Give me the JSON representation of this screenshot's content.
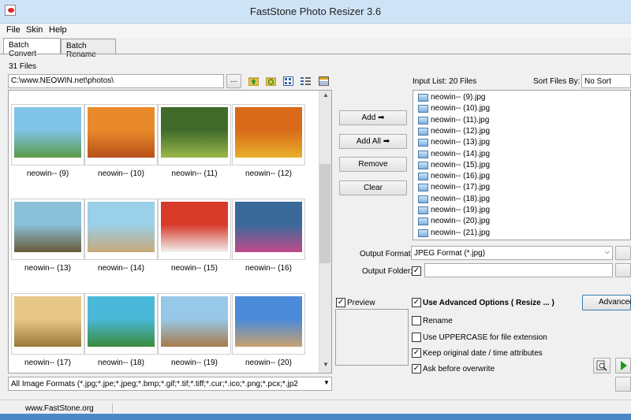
{
  "window": {
    "title": "FastStone Photo Resizer 3.6"
  },
  "menu": [
    "File",
    "Skin",
    "Help"
  ],
  "tabs": [
    "Batch Convert",
    "Batch Rename"
  ],
  "files_count": "31 Files",
  "path": "C:\\www.NEOWIN.net\\photos\\",
  "browse_label": "...",
  "thumbnails": [
    "neowin-- (9)",
    "neowin-- (10)",
    "neowin-- (11)",
    "neowin-- (12)",
    "neowin-- (13)",
    "neowin-- (14)",
    "neowin-- (15)",
    "neowin-- (16)",
    "neowin-- (17)",
    "neowin-- (18)",
    "neowin-- (19)",
    "neowin-- (20)"
  ],
  "format_filter": "All Image Formats (*.jpg;*.jpe;*.jpeg;*.bmp;*.gif;*.tif;*.tiff;*.cur;*.ico;*.png;*.pcx;*.jp2",
  "buttons": {
    "add": "Add",
    "add_all": "Add All",
    "remove": "Remove",
    "clear": "Clear",
    "advanced": "Advanced"
  },
  "input_list_label": "Input List:  20 Files",
  "sort_label": "Sort Files By:",
  "sort_value": "No Sort",
  "input_list": [
    "neowin-- (9).jpg",
    "neowin-- (10).jpg",
    "neowin-- (11).jpg",
    "neowin-- (12).jpg",
    "neowin-- (13).jpg",
    "neowin-- (14).jpg",
    "neowin-- (15).jpg",
    "neowin-- (16).jpg",
    "neowin-- (17).jpg",
    "neowin-- (18).jpg",
    "neowin-- (19).jpg",
    "neowin-- (20).jpg",
    "neowin-- (21).jpg"
  ],
  "output_format_label": "Output Format:",
  "output_format_value": "JPEG Format (*.jpg)",
  "output_folder_label": "Output Folder:",
  "preview_label": "Preview",
  "options": {
    "advanced": "Use Advanced Options ( Resize ... )",
    "rename": "Rename",
    "uppercase": "Use UPPERCASE for file extension",
    "keep_date": "Keep original date / time attributes",
    "ask_overwrite": "Ask before overwrite"
  },
  "status": "www.FastStone.org"
}
